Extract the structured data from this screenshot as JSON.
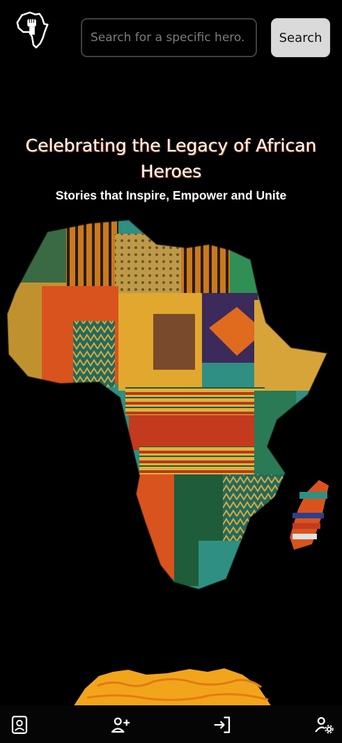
{
  "header": {
    "logo_icon": "africa-fist-logo-icon",
    "search": {
      "placeholder": "Search for a specific hero.",
      "value": ""
    },
    "search_button_label": "Search"
  },
  "hero": {
    "title": "Celebrating the Legacy of African Heroes",
    "subtitle": "Stories that Inspire, Empower and Unite"
  },
  "bottom_nav": {
    "items": [
      {
        "icon": "contact-card-icon"
      },
      {
        "icon": "add-user-icon"
      },
      {
        "icon": "login-icon"
      },
      {
        "icon": "user-settings-icon"
      }
    ]
  },
  "colors": {
    "background": "#000000",
    "button_bg": "#dadada",
    "input_border": "#3f3f3f",
    "map_orange": "#d9531e",
    "map_gold": "#e2a72e",
    "map_teal": "#2f8f82",
    "map_green": "#1f5c3a"
  }
}
